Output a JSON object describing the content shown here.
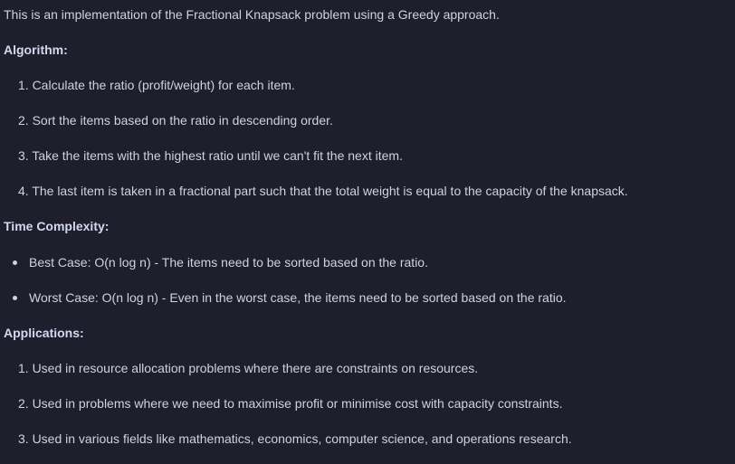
{
  "intro": "This is an implementation of the Fractional Knapsack problem using a Greedy approach.",
  "algorithm": {
    "heading": "Algorithm:",
    "steps": [
      "1. Calculate the ratio (profit/weight) for each item.",
      "2. Sort the items based on the ratio in descending order.",
      "3. Take the items with the highest ratio until we can't fit the next item.",
      "4. The last item is taken in a fractional part such that the total weight is equal to the capacity of the knapsack."
    ]
  },
  "complexity": {
    "heading": "Time Complexity:",
    "bullets": [
      "Best Case: O(n log n) - The items need to be sorted based on the ratio.",
      "Worst Case: O(n log n) - Even in the worst case, the items need to be sorted based on the ratio."
    ]
  },
  "applications": {
    "heading": "Applications:",
    "items": [
      "1. Used in resource allocation problems where there are constraints on resources.",
      "2. Used in problems where we need to maximise profit or minimise cost with capacity constraints.",
      "3. Used in various fields like mathematics, economics, computer science, and operations research."
    ]
  }
}
